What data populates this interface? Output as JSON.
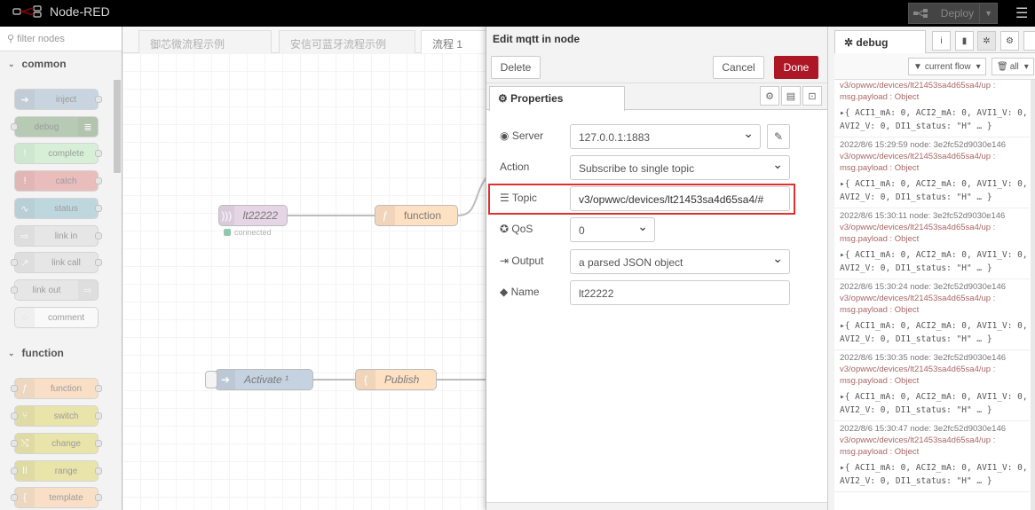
{
  "header": {
    "title": "Node-RED",
    "deploy_label": "Deploy"
  },
  "palette": {
    "filter_placeholder": "filter nodes",
    "categories": [
      {
        "name": "common",
        "nodes": [
          "inject",
          "debug",
          "complete",
          "catch",
          "status",
          "link in",
          "link call",
          "link out",
          "comment"
        ]
      },
      {
        "name": "function",
        "nodes": [
          "function",
          "switch",
          "change",
          "range",
          "template"
        ]
      }
    ]
  },
  "workspace": {
    "tabs": [
      "御芯微流程示例",
      "安信可蓝牙流程示例",
      "流程 1"
    ],
    "nodes": [
      {
        "label": "lt22222",
        "status": "connected"
      },
      {
        "label": "function"
      },
      {
        "label": "Activate ¹"
      },
      {
        "label": "Publish"
      }
    ]
  },
  "tray": {
    "title": "Edit mqtt in node",
    "delete_label": "Delete",
    "cancel_label": "Cancel",
    "done_label": "Done",
    "properties_tab": "Properties",
    "fields": {
      "server": {
        "label": "Server",
        "value": "127.0.0.1:1883"
      },
      "action": {
        "label": "Action",
        "value": "Subscribe to single topic"
      },
      "topic": {
        "label": "Topic",
        "value": "v3/opwwc/devices/lt21453sa4d65sa4/#"
      },
      "qos": {
        "label": "QoS",
        "value": "0"
      },
      "output": {
        "label": "Output",
        "value": "a parsed JSON object"
      },
      "name": {
        "label": "Name",
        "value": "lt22222"
      }
    }
  },
  "sidebar": {
    "tab_label": "debug",
    "filter_label": "current flow",
    "clear_label": "all",
    "messages": [
      {
        "time": "",
        "topic": "v3/opwwc/devices/lt21453sa4d65sa4/up :",
        "type": "msg.payload : Object",
        "object": [
          "▸{ ACI1_mA: 0, ACI2_mA: 0, AVI1_V: 0,",
          "AVI2_V: 0, DI1_status: \"H\" … }"
        ]
      },
      {
        "time": "2022/8/6 15:29:59  node: 3e2fc52d9030e146",
        "topic": "v3/opwwc/devices/lt21453sa4d65sa4/up :",
        "type": "msg.payload : Object",
        "object": [
          "▸{ ACI1_mA: 0, ACI2_mA: 0, AVI1_V: 0,",
          "AVI2_V: 0, DI1_status: \"H\" … }"
        ]
      },
      {
        "time": "2022/8/6 15:30:11  node: 3e2fc52d9030e146",
        "topic": "v3/opwwc/devices/lt21453sa4d65sa4/up :",
        "type": "msg.payload : Object",
        "object": [
          "▸{ ACI1_mA: 0, ACI2_mA: 0, AVI1_V: 0,",
          "AVI2_V: 0, DI1_status: \"H\" … }"
        ]
      },
      {
        "time": "2022/8/6 15:30:24  node: 3e2fc52d9030e146",
        "topic": "v3/opwwc/devices/lt21453sa4d65sa4/up :",
        "type": "msg.payload : Object",
        "object": [
          "▸{ ACI1_mA: 0, ACI2_mA: 0, AVI1_V: 0,",
          "AVI2_V: 0, DI1_status: \"H\" … }"
        ]
      },
      {
        "time": "2022/8/6 15:30:35  node: 3e2fc52d9030e146",
        "topic": "v3/opwwc/devices/lt21453sa4d65sa4/up :",
        "type": "msg.payload : Object",
        "object": [
          "▸{ ACI1_mA: 0, ACI2_mA: 0, AVI1_V: 0,",
          "AVI2_V: 0, DI1_status: \"H\" … }"
        ]
      },
      {
        "time": "2022/8/6 15:30:47  node: 3e2fc52d9030e146",
        "topic": "v3/opwwc/devices/lt21453sa4d65sa4/up :",
        "type": "msg.payload : Object",
        "object": [
          "▸{ ACI1_mA: 0, ACI2_mA: 0, AVI1_V: 0,",
          "AVI2_V: 0, DI1_status: \"H\" … }"
        ]
      }
    ]
  },
  "colors": {
    "accent": "#ad1625",
    "highlight": "#e03030",
    "header_bg": "#000000"
  }
}
